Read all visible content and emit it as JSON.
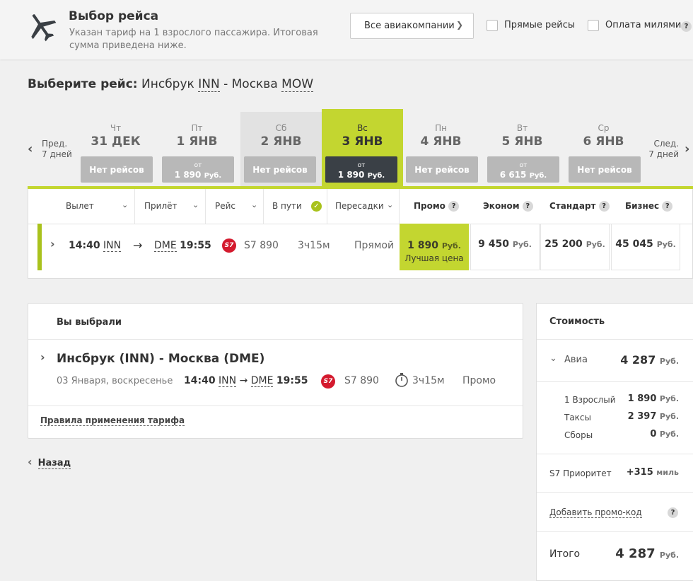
{
  "header": {
    "title": "Выбор рейса",
    "subtitle": "Указан тариф на 1 взрослого пассажира. Итоговая сумма приведена ниже.",
    "airline_select": "Все авиакомпании",
    "direct_label": "Прямые рейсы",
    "miles_label": "Оплата милями",
    "help": "?"
  },
  "route": {
    "prefix": "Выберите рейс:",
    "from_city": "Инсбрук",
    "from_code": "INN",
    "dash": "-",
    "to_city": "Москва",
    "to_code": "MOW"
  },
  "calendar": {
    "prev_label": "Пред.",
    "prev_sub": "7 дней",
    "next_label": "След.",
    "next_sub": "7 дней",
    "days": [
      {
        "dow": "Чт",
        "date": "31 ДЕК",
        "kind": "none",
        "label": "Нет рейсов"
      },
      {
        "dow": "Пт",
        "date": "1 ЯНВ",
        "kind": "price",
        "from": "от",
        "price": "1 890",
        "cur": "Руб."
      },
      {
        "dow": "Сб",
        "date": "2 ЯНВ",
        "kind": "none",
        "label": "Нет рейсов"
      },
      {
        "dow": "Вс",
        "date": "3 ЯНВ",
        "kind": "price",
        "from": "от",
        "price": "1 890",
        "cur": "Руб."
      },
      {
        "dow": "Пн",
        "date": "4 ЯНВ",
        "kind": "none",
        "label": "Нет рейсов"
      },
      {
        "dow": "Вт",
        "date": "5 ЯНВ",
        "kind": "price",
        "from": "от",
        "price": "6 615",
        "cur": "Руб."
      },
      {
        "dow": "Ср",
        "date": "6 ЯНВ",
        "kind": "none",
        "label": "Нет рейсов"
      }
    ]
  },
  "table": {
    "col_departure": "Вылет",
    "col_arrival": "Прилёт",
    "col_flight": "Рейс",
    "col_duration": "В пути",
    "col_transfers": "Пересадки",
    "fare_promo": "Промо",
    "fare_economy": "Эконом",
    "fare_standard": "Стандарт",
    "fare_business": "Бизнес",
    "row": {
      "dep_time": "14:40",
      "dep_code": "INN",
      "arrow": "→",
      "arr_code": "DME",
      "arr_time": "19:55",
      "airline_logo": "S7",
      "flight": "S7 890",
      "duration": "3ч15м",
      "transfers": "Прямой",
      "promo_price": "1 890",
      "promo_note": "Лучшая цена",
      "economy_price": "9 450",
      "standard_price": "25 200",
      "business_price": "45 045",
      "cur": "Руб."
    }
  },
  "selected": {
    "heading": "Вы выбрали",
    "route": "Инсбрук (INN) - Москва (DME)",
    "date": "03 Января, воскресенье",
    "dep_time": "14:40",
    "dep_code": "INN",
    "arrow": "→",
    "arr_code": "DME",
    "arr_time": "19:55",
    "flight": "S7 890",
    "duration": "3ч15м",
    "fare": "Промо",
    "rules_link": "Правила применения тарифа"
  },
  "back_label": "Назад",
  "cost": {
    "heading": "Стоимость",
    "avia_label": "Авиа",
    "avia_value": "4 287",
    "adult_label": "1 Взрослый",
    "adult_value": "1 890",
    "taxes_label": "Таксы",
    "taxes_value": "2 397",
    "fees_label": "Сборы",
    "fees_value": "0",
    "priority_label": "S7 Приоритет",
    "priority_value": "+315",
    "miles_unit": "миль",
    "promo_link": "Добавить промо-код",
    "total_label": "Итого",
    "total_value": "4 287",
    "cur": "Руб."
  },
  "colors": {
    "accent": "#c3d630",
    "accent_dark": "#a9c21c",
    "dark": "#3a4046",
    "s7_red": "#d41a2e"
  }
}
